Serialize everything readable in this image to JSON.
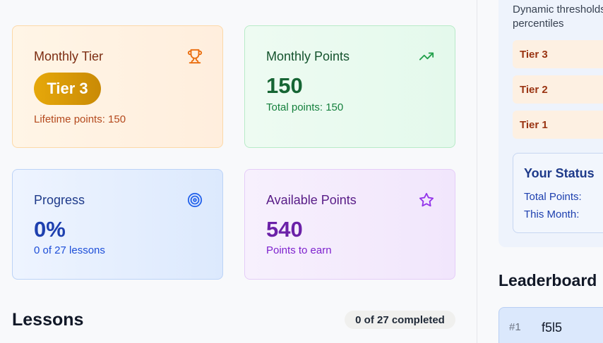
{
  "cards": {
    "tier": {
      "title": "Monthly Tier",
      "badge": "Tier 3",
      "sub": "Lifetime points: 150",
      "icon": "trophy-icon",
      "accent": "#ea6c0c"
    },
    "monthly": {
      "title": "Monthly Points",
      "value": "150",
      "sub": "Total points: 150",
      "icon": "trending-up-icon",
      "accent": "#22a04b"
    },
    "progress": {
      "title": "Progress",
      "value": "0%",
      "sub": "0 of 27 lessons",
      "icon": "target-icon",
      "accent": "#2563eb"
    },
    "available": {
      "title": "Available Points",
      "value": "540",
      "sub": "Points to earn",
      "icon": "star-icon",
      "accent": "#9333ea"
    }
  },
  "lessons": {
    "title": "Lessons",
    "completed": "0 of 27 completed"
  },
  "sidebar": {
    "description_line1": "Dynamic thresholds",
    "description_line2": "percentiles",
    "tiers": [
      "Tier 3",
      "Tier 2",
      "Tier 1"
    ],
    "status": {
      "title": "Your Status",
      "total_label": "Total Points:",
      "month_label": "This Month:"
    },
    "leaderboard": {
      "title": "Leaderboard",
      "rows": [
        {
          "rank": "#1",
          "name": "f5l5"
        }
      ]
    }
  }
}
